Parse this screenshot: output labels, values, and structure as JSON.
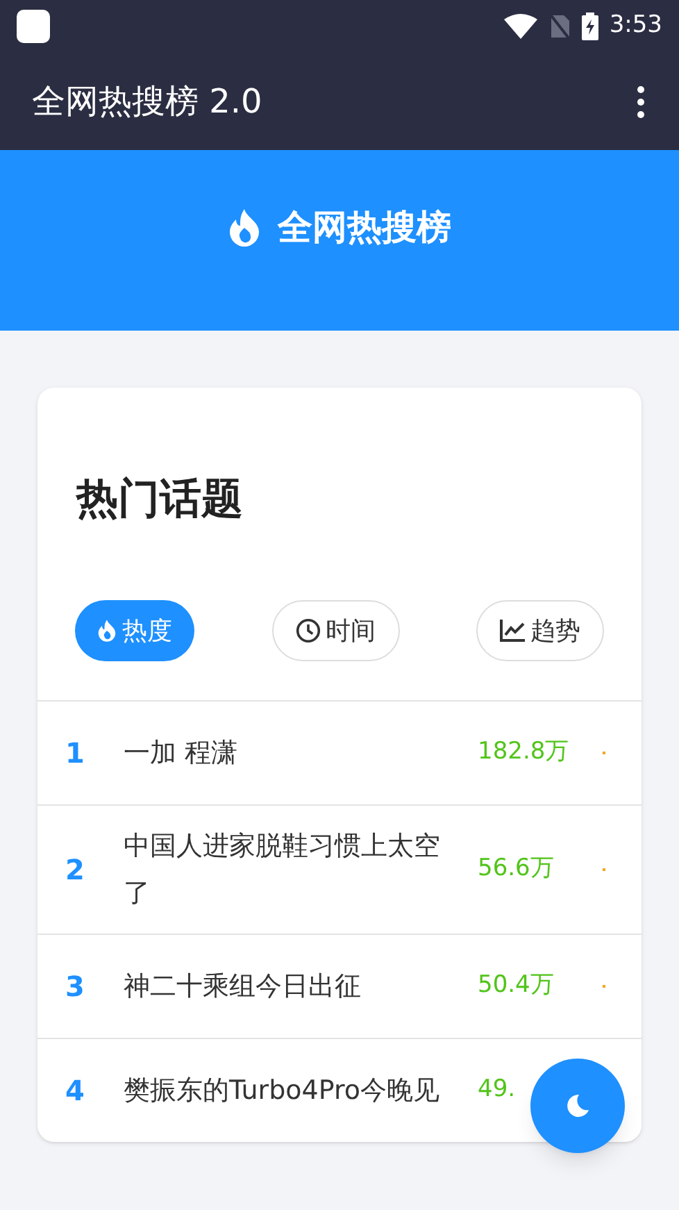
{
  "status_bar": {
    "time": "3:53"
  },
  "app_bar": {
    "title": "全网热搜榜 2.0"
  },
  "banner": {
    "title": "全网热搜榜"
  },
  "card": {
    "title": "热门话题",
    "sort_tabs": [
      {
        "label": "热度",
        "kind": "flame",
        "selected": true
      },
      {
        "label": "时间",
        "kind": "clock",
        "selected": false
      },
      {
        "label": "趋势",
        "kind": "trend",
        "selected": false
      }
    ],
    "rows": [
      {
        "rank": "1",
        "title": "一加 程潇",
        "heat": "182.8万"
      },
      {
        "rank": "2",
        "title": "中国人进家脱鞋习惯上太空了",
        "heat": "56.6万"
      },
      {
        "rank": "3",
        "title": "神二十乘组今日出征",
        "heat": "50.4万"
      },
      {
        "rank": "4",
        "title": "樊振东的Turbo4Pro今晚见",
        "heat": "49."
      }
    ]
  }
}
